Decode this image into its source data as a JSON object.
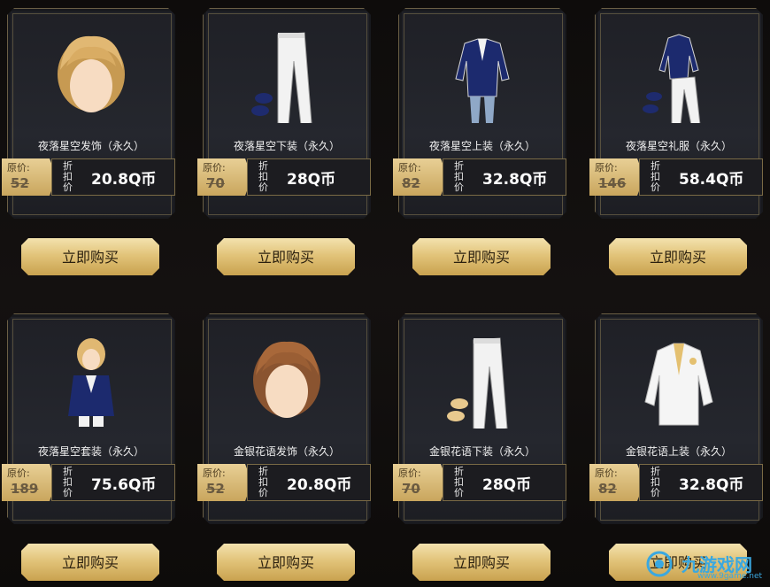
{
  "labels": {
    "original": "原价:",
    "discount": "折扣价",
    "buy": "立即购买"
  },
  "items": [
    {
      "name": "夜落星空发饰（永久）",
      "original": "52",
      "price": "20.8Q币",
      "type": "hair-blonde"
    },
    {
      "name": "夜落星空下装（永久）",
      "original": "70",
      "price": "28Q币",
      "type": "pants"
    },
    {
      "name": "夜落星空上装（永久）",
      "original": "82",
      "price": "32.8Q币",
      "type": "jacket-blue"
    },
    {
      "name": "夜落星空礼服（永久）",
      "original": "146",
      "price": "58.4Q币",
      "type": "suit-set"
    },
    {
      "name": "夜落星空套装（永久）",
      "original": "189",
      "price": "75.6Q币",
      "type": "avatar"
    },
    {
      "name": "金银花语发饰（永久）",
      "original": "52",
      "price": "20.8Q币",
      "type": "hair-brown"
    },
    {
      "name": "金银花语下装（永久）",
      "original": "70",
      "price": "28Q币",
      "type": "pants-gold"
    },
    {
      "name": "金银花语上装（永久）",
      "original": "82",
      "price": "32.8Q币",
      "type": "jacket-white"
    }
  ],
  "watermark": {
    "text": "九游戏网",
    "url": "www.9game.net"
  },
  "colors": {
    "gold": "#e2c47a",
    "frame": "#6b5f45",
    "card_bg": "#23252b"
  }
}
